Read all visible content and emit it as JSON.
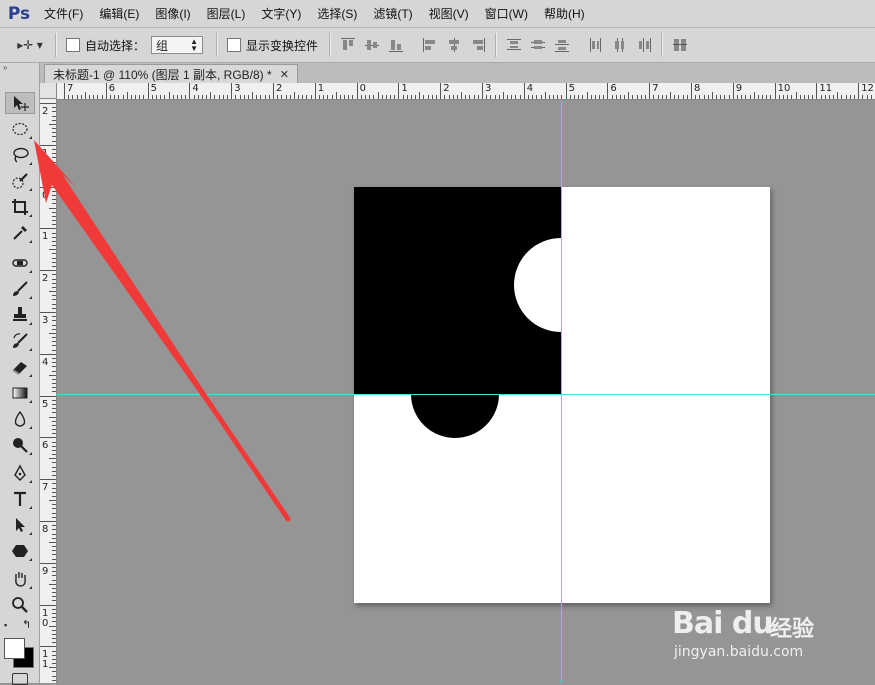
{
  "app": {
    "logo": "Ps"
  },
  "menu": [
    "文件(F)",
    "编辑(E)",
    "图像(I)",
    "图层(L)",
    "文字(Y)",
    "选择(S)",
    "滤镜(T)",
    "视图(V)",
    "窗口(W)",
    "帮助(H)"
  ],
  "options": {
    "move_tool_glyph": "▸✛ ▾",
    "auto_select_label": "自动选择：",
    "auto_select_checked": false,
    "auto_select_mode": "组",
    "show_transform_label": "显示变换控件",
    "show_transform_checked": false
  },
  "document": {
    "tab_title": "未标题-1 @ 110% (图层 1 副本, RGB/8) *",
    "zoom": "110%",
    "layer": "图层 1 副本",
    "mode": "RGB/8"
  },
  "ruler": {
    "horizontal": [
      "7",
      "6",
      "5",
      "4",
      "3",
      "2",
      "1",
      "0",
      "1",
      "2",
      "3",
      "4",
      "5",
      "6",
      "7",
      "8",
      "9",
      "10",
      "11",
      "12"
    ],
    "vertical": [
      "2",
      "1",
      "0",
      "1",
      "2",
      "3",
      "4",
      "5",
      "6",
      "7",
      "8",
      "9",
      "1\n0",
      "1\n1"
    ]
  },
  "tools": [
    {
      "name": "move-tool",
      "icon": "move-icon",
      "active": true
    },
    {
      "name": "marquee-tool",
      "icon": "ellipse-marquee-icon",
      "active": false
    },
    {
      "name": "lasso-tool",
      "icon": "lasso-icon",
      "active": false
    },
    {
      "name": "quick-select-tool",
      "icon": "quick-select-icon",
      "active": false
    },
    {
      "name": "crop-tool",
      "icon": "crop-icon",
      "active": false
    },
    {
      "name": "eyedropper-tool",
      "icon": "eyedropper-icon",
      "active": false
    },
    {
      "name": "healing-tool",
      "icon": "healing-icon",
      "active": false
    },
    {
      "name": "brush-tool",
      "icon": "brush-icon",
      "active": false
    },
    {
      "name": "stamp-tool",
      "icon": "stamp-icon",
      "active": false
    },
    {
      "name": "history-brush-tool",
      "icon": "history-brush-icon",
      "active": false
    },
    {
      "name": "eraser-tool",
      "icon": "eraser-icon",
      "active": false
    },
    {
      "name": "gradient-tool",
      "icon": "gradient-icon",
      "active": false
    },
    {
      "name": "blur-tool",
      "icon": "blur-icon",
      "active": false
    },
    {
      "name": "dodge-tool",
      "icon": "dodge-icon",
      "active": false
    },
    {
      "name": "pen-tool",
      "icon": "pen-icon",
      "active": false
    },
    {
      "name": "type-tool",
      "icon": "type-icon",
      "active": false
    },
    {
      "name": "path-select-tool",
      "icon": "path-select-icon",
      "active": false
    },
    {
      "name": "shape-tool",
      "icon": "polygon-icon",
      "active": false
    },
    {
      "name": "hand-tool",
      "icon": "hand-icon",
      "active": false
    },
    {
      "name": "zoom-tool",
      "icon": "zoom-icon",
      "active": false
    }
  ],
  "colors": {
    "foreground": "#ffffff",
    "background": "#000000",
    "guide": "#3fe0e0",
    "arrow": "#f03a3a",
    "workspace": "#959595"
  },
  "watermark": {
    "brand": "Bai du",
    "product": "经验",
    "url": "jingyan.baidu.com"
  }
}
